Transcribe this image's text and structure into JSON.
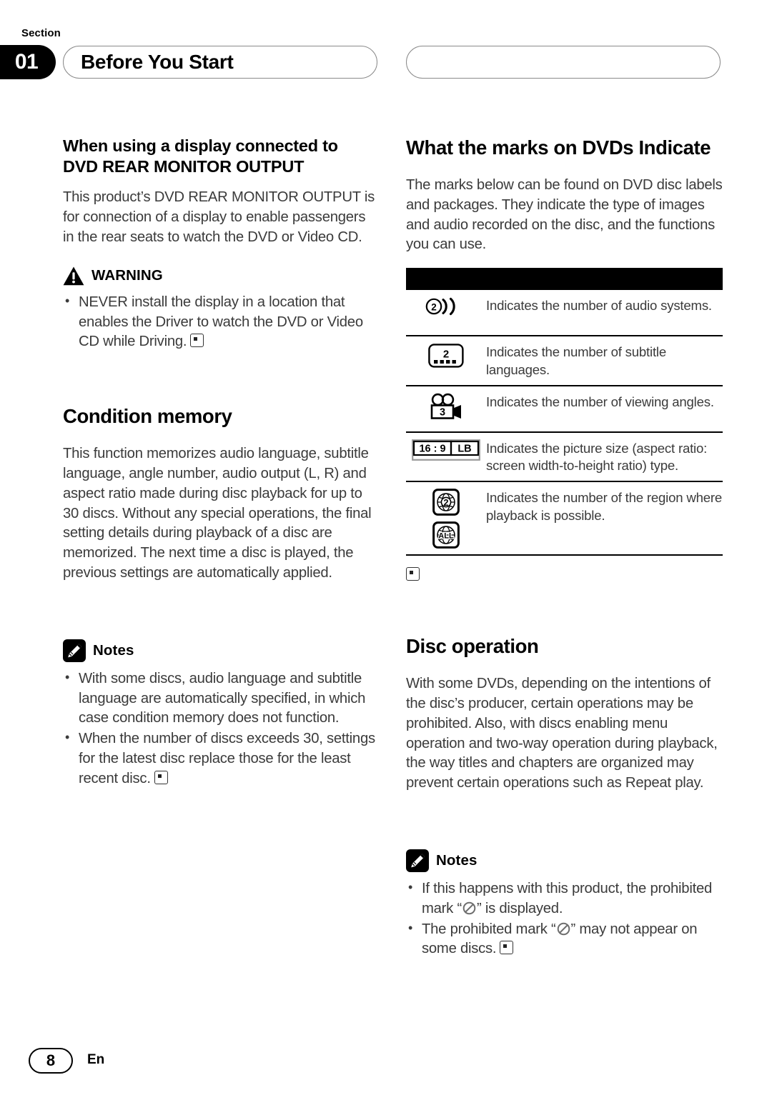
{
  "header": {
    "section_word": "Section",
    "section_number": "01",
    "title": "Before You Start",
    "right_pill_title": ""
  },
  "left_column": {
    "heading_line1": "When using a display connected to",
    "heading_line2": "DVD REAR MONITOR OUTPUT",
    "intro_paragraph": "This product’s DVD REAR MONITOR OUTPUT is for connection of a display to enable passengers in the rear seats to watch the DVD or Video CD.",
    "warning": {
      "icon": "warning-triangle-icon",
      "label": "WARNING",
      "bullets": [
        "NEVER install the display in a location that enables the Driver to watch the DVD or Video CD while Driving."
      ]
    },
    "condition_memory": {
      "heading": "Condition memory",
      "paragraph": "This function memorizes audio language, subtitle language, angle number, audio output (L, R) and aspect ratio made during disc playback for up to 30 discs. Without any special operations, the final setting details during playback of a disc are memorized. The next time a disc is played, the previous settings are automatically applied."
    },
    "notes": {
      "icon": "pencil-note-icon",
      "label": "Notes",
      "bullets": [
        "With some discs, audio language and subtitle language are automatically specified, in which case condition memory does not function.",
        "When the number of discs exceeds 30, settings for the latest disc replace those for the least recent disc."
      ]
    }
  },
  "right_column": {
    "marks_heading": "What the marks on DVDs Indicate",
    "marks_intro": "The marks below can be found on DVD disc labels and packages. They indicate the type of images and audio recorded on the disc, and the functions you can use.",
    "marks_table": {
      "header_bar_label": "",
      "rows": [
        {
          "icon": "audio-systems-mark-icon",
          "icon_value": "2",
          "description": "Indicates the number of audio systems."
        },
        {
          "icon": "subtitle-languages-mark-icon",
          "icon_value": "2",
          "description": "Indicates the number of subtitle languages."
        },
        {
          "icon": "viewing-angles-camera-mark-icon",
          "icon_value": "3",
          "description": "Indicates the number of viewing angles."
        },
        {
          "icon": "aspect-ratio-mark-icon",
          "icon_value": "16 : 9",
          "icon_value_2": "LB",
          "description": "Indicates the picture size (aspect ratio: screen width-to-height ratio) type."
        },
        {
          "icon": "region-code-mark-icon",
          "icon_value": "2",
          "icon_value_2": "ALL",
          "description": "Indicates the number of the region where playback is possible."
        }
      ]
    },
    "disc_operation": {
      "heading": "Disc operation",
      "paragraph": "With some DVDs, depending on the intentions of the disc’s producer, certain operations may be prohibited. Also, with discs enabling menu operation and two-way operation during playback, the way titles and chapters are organized may prevent certain operations such as Repeat play."
    },
    "notes": {
      "icon": "pencil-note-icon",
      "label": "Notes",
      "bullets": [
        {
          "before": "If this happens with this product, the prohibited mark “",
          "after": "” is displayed.",
          "has_endmark": false
        },
        {
          "before": "The prohibited mark “",
          "after": "” may not appear on some discs.",
          "has_endmark": true
        }
      ]
    }
  },
  "footer": {
    "page_number": "8",
    "language_code": "En"
  },
  "colors": {
    "ink": "#231f20",
    "body_text": "#3b3b3b",
    "rule": "#000000",
    "pill_border": "#8a8a8a"
  }
}
